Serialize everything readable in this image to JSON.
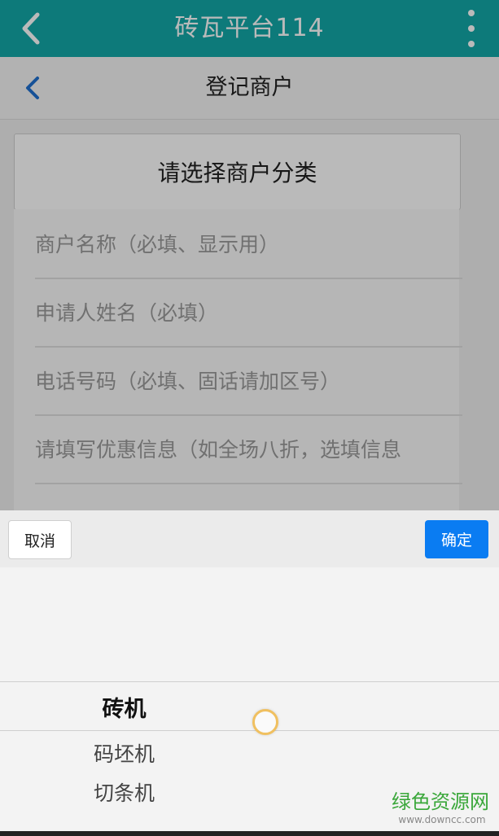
{
  "app_bar": {
    "title": "砖瓦平台114",
    "back_icon": "chevron-left-icon",
    "menu_icon": "more-vertical-icon",
    "color": "#13a8a8"
  },
  "sub_header": {
    "title": "登记商户",
    "back_icon": "chevron-left-icon",
    "accent": "#1f6fcf"
  },
  "form": {
    "category_button": "请选择商户分类",
    "fields": [
      {
        "placeholder": "商户名称（必填、显示用）"
      },
      {
        "placeholder": "申请人姓名（必填）"
      },
      {
        "placeholder": "电话号码（必填、固话请加区号）"
      },
      {
        "placeholder": "请填写优惠信息（如全场八折，选填信息"
      }
    ]
  },
  "picker": {
    "cancel_label": "取消",
    "confirm_label": "确定",
    "confirm_color": "#0a7cf2",
    "selected": "砖机",
    "options": [
      "码坯机",
      "切条机"
    ]
  },
  "watermark": {
    "text": "绿色资源网",
    "url": "www.downcc.com"
  }
}
